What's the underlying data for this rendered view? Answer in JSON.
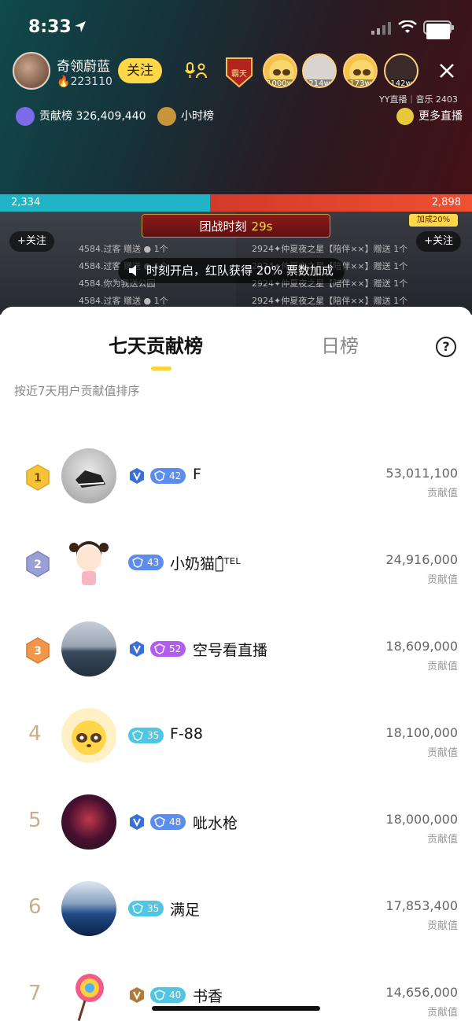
{
  "status": {
    "time": "8:33"
  },
  "host": {
    "name": "奇领蔚蓝",
    "fans": "223110",
    "follow_label": "关注"
  },
  "viewers": [
    {
      "count": "1000w"
    },
    {
      "count": "214w"
    },
    {
      "count": "173w"
    },
    {
      "count": "142w"
    }
  ],
  "shield_badge": "霸天",
  "yy_tag": "YY直播｜音乐 2403",
  "contrib": {
    "label": "贡献榜",
    "value": "326,409,440"
  },
  "hour_label": "小时榜",
  "more_label": "更多直播",
  "pk": {
    "left_score": "2,334",
    "right_score": "2,898",
    "title": "团战时刻",
    "seconds": "29s",
    "bonus": "加成20%",
    "follow_left": "+关注",
    "follow_right": "+关注"
  },
  "notice": "时刻开启，红队获得 20% 票数加成",
  "gift_rows": [
    {
      "text": "4584.过客  赠送  ● 1个"
    },
    {
      "text": "4584.过客  赠送  ● 1个"
    },
    {
      "text": "4584.你为我送公园"
    },
    {
      "text": "4584.过客  赠送  ● 1个"
    },
    {
      "text": "2924✦仲夏夜之星【陪伴××】赠送 1个"
    },
    {
      "text": "2924✦仲夏夜之星【陪伴××】赠送 1个"
    },
    {
      "text": "2924✦仲夏夜之星【陪伴××】赠送 1个"
    },
    {
      "text": "2924✦仲夏夜之星【陪伴××】赠送 1个"
    }
  ],
  "sheet": {
    "tab_weekly": "七天贡献榜",
    "tab_daily": "日榜",
    "help": "?",
    "subtitle": "按近7天用户贡献值排序",
    "score_label": "贡献值"
  },
  "ranking": [
    {
      "rank": "1",
      "level": "42",
      "name": "F",
      "score": "53,011,100",
      "medal": true,
      "lvl_color": "#5b8cf0"
    },
    {
      "rank": "2",
      "level": "43",
      "name": "小奶猫ঞ͒ᵀᴱᴸ",
      "score": "24,916,000",
      "medal": false,
      "lvl_color": "#5b8cf0"
    },
    {
      "rank": "3",
      "level": "52",
      "name": "空号看直播",
      "score": "18,609,000",
      "medal": true,
      "lvl_color": "#b25cf0"
    },
    {
      "rank": "4",
      "level": "35",
      "name": "F-88",
      "score": "18,100,000",
      "medal": false,
      "lvl_color": "#4fc6e4"
    },
    {
      "rank": "5",
      "level": "48",
      "name": "呲水枪",
      "score": "18,000,000",
      "medal": true,
      "lvl_color": "#5b8cf0"
    },
    {
      "rank": "6",
      "level": "35",
      "name": "满足",
      "score": "17,853,400",
      "medal": false,
      "lvl_color": "#4fc6e4"
    },
    {
      "rank": "7",
      "level": "40",
      "name": "书香",
      "score": "14,656,000",
      "medal": true,
      "lvl_color": "#4fc6e4"
    }
  ],
  "colors": {
    "accent": "#ffd23a",
    "pk_blue": "#1fb5c7",
    "pk_red": "#e04330"
  }
}
